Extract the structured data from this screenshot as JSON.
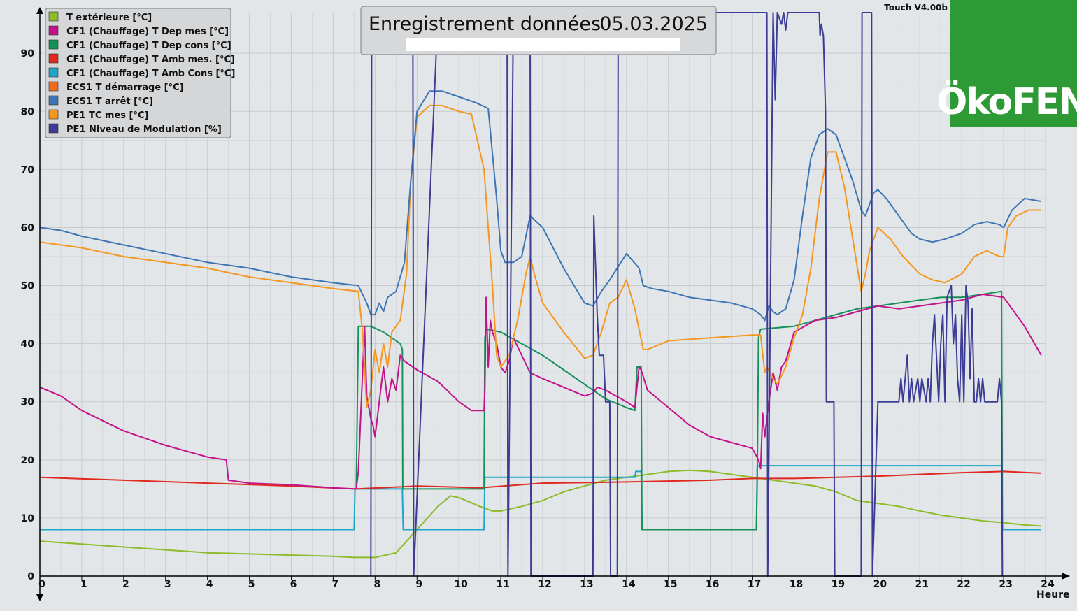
{
  "window": {
    "title_left": "Enregistrement données",
    "title_date": "05.03.2025",
    "version": "Touch V4.00b",
    "logo_text": "ÖkoFEN",
    "logo_bg": "#2e9a36"
  },
  "chart_data": {
    "type": "line",
    "title": "Enregistrement données 05.03.2025",
    "xlabel": "Heure",
    "ylabel": "",
    "xlim": [
      0,
      24
    ],
    "ylim": [
      0,
      97
    ],
    "xticks": [
      0,
      1,
      2,
      3,
      4,
      5,
      6,
      7,
      8,
      9,
      10,
      11,
      12,
      13,
      14,
      15,
      16,
      17,
      18,
      19,
      20,
      21,
      22,
      23,
      24
    ],
    "yticks": [
      0,
      10,
      20,
      30,
      40,
      50,
      60,
      70,
      80,
      90
    ],
    "grid": true,
    "legend_position": "top-left",
    "series": [
      {
        "name": "T extérieure [°C]",
        "color": "#8dbb2a",
        "x": [
          0,
          1,
          2,
          3,
          4,
          5,
          6,
          7,
          7.5,
          8,
          8.5,
          9,
          9.5,
          9.8,
          10,
          10.5,
          10.8,
          11,
          11.5,
          12,
          12.5,
          13,
          13.5,
          14,
          14.5,
          15,
          15.5,
          16,
          16.5,
          17,
          17.5,
          18,
          18.5,
          19,
          19.5,
          20,
          20.5,
          21,
          21.5,
          22,
          22.5,
          23,
          23.5,
          23.9
        ],
        "y": [
          6,
          5.5,
          5,
          4.5,
          4,
          3.8,
          3.6,
          3.4,
          3.2,
          3.2,
          4,
          8,
          12,
          13.8,
          13.5,
          12,
          11.2,
          11.2,
          12,
          13,
          14.5,
          15.5,
          16.5,
          17,
          17.5,
          18,
          18.2,
          18,
          17.5,
          17,
          16.5,
          16,
          15.5,
          14.5,
          13,
          12.5,
          12,
          11.2,
          10.5,
          10,
          9.5,
          9.2,
          8.8,
          8.6
        ]
      },
      {
        "name": "CF1 (Chauffage) T Dep mes [°C]",
        "color": "#c3138a",
        "x": [
          0,
          0.5,
          1,
          2,
          3,
          4,
          4.45,
          4.5,
          5,
          6,
          7,
          7.55,
          7.6,
          7.7,
          7.75,
          7.8,
          7.9,
          7.95,
          8,
          8.1,
          8.2,
          8.3,
          8.4,
          8.5,
          8.6,
          8.7,
          9,
          9.5,
          10,
          10.3,
          10.6,
          10.62,
          10.65,
          10.7,
          10.75,
          10.8,
          10.9,
          11,
          11.1,
          11.2,
          11.3,
          11.5,
          11.7,
          12,
          12.5,
          13,
          13.2,
          13.3,
          13.5,
          14,
          14.2,
          14.3,
          14.35,
          14.5,
          15,
          15.5,
          16,
          16.5,
          17,
          17.15,
          17.2,
          17.25,
          17.3,
          17.4,
          17.5,
          17.6,
          17.7,
          17.8,
          18,
          18.5,
          19,
          19.5,
          20,
          20.5,
          21,
          21.5,
          22,
          22.5,
          23,
          23.5,
          23.9
        ],
        "y": [
          32.5,
          31,
          28.5,
          25,
          22.5,
          20.5,
          20,
          16.5,
          16,
          15.7,
          15.2,
          15,
          18,
          35,
          43,
          31,
          27,
          26,
          24,
          30,
          36,
          30,
          34,
          32,
          38,
          37,
          35.5,
          33.5,
          30,
          28.5,
          28.5,
          32,
          48,
          36,
          44,
          42,
          40,
          36,
          35,
          37,
          41,
          38,
          35,
          34,
          32.5,
          31,
          31.5,
          32.5,
          32,
          30,
          29,
          36,
          35.5,
          32,
          29,
          26,
          24,
          23,
          22,
          20,
          18.5,
          28,
          24,
          30,
          35,
          32,
          36,
          37,
          42,
          44,
          44.5,
          45.5,
          46.5,
          46,
          46.5,
          47,
          47.5,
          48.5,
          48,
          43,
          38
        ]
      },
      {
        "name": "CF1 (Chauffage) T Dep cons [°C]",
        "color": "#14925a",
        "x": [
          7.55,
          7.6,
          7.9,
          8.2,
          8.4,
          8.6,
          8.65,
          8.66,
          10.58,
          10.6,
          10.62,
          10.65,
          11,
          11.5,
          12,
          12.5,
          13,
          13.5,
          14,
          14.2,
          14.25,
          14.35,
          14.37,
          17.1,
          17.12,
          17.15,
          17.2,
          18,
          18.5,
          19,
          19.5,
          20,
          20.5,
          21,
          21.5,
          22,
          22.5,
          22.95,
          22.97
        ],
        "y": [
          15,
          43,
          43,
          42,
          41,
          40,
          39,
          15,
          15,
          15,
          41,
          42.5,
          42,
          40,
          38,
          35.5,
          33,
          30.5,
          29,
          28.5,
          36,
          36,
          8,
          8,
          17,
          41,
          42.5,
          43,
          44,
          45,
          46,
          46.5,
          47,
          47.5,
          48,
          48,
          48.5,
          49,
          8
        ]
      },
      {
        "name": "CF1 (Chauffage) T Amb mes. [°C]",
        "color": "#e0281e",
        "x": [
          0,
          2,
          4,
          6,
          7.5,
          9,
          10.5,
          12,
          14,
          16,
          17,
          18,
          20,
          22,
          23,
          23.9
        ],
        "y": [
          17,
          16.5,
          16,
          15.5,
          15,
          15.5,
          15.2,
          16,
          16.2,
          16.5,
          16.8,
          16.8,
          17.2,
          17.8,
          18,
          17.7
        ]
      },
      {
        "name": "CF1 (Chauffage) T Amb Cons [°C]",
        "color": "#1ea5c8",
        "x": [
          0,
          7.5,
          7.52,
          8.65,
          8.67,
          10.6,
          10.62,
          14.2,
          14.22,
          14.35,
          14.37,
          17.1,
          17.12,
          22.95,
          22.97,
          23.9
        ],
        "y": [
          8,
          8,
          15,
          15,
          8,
          8,
          17,
          17,
          18,
          18,
          8,
          8,
          19,
          19,
          8,
          8
        ]
      },
      {
        "name": "ECS1 T démarrage [°C]",
        "color": "#ec6d22",
        "x": [],
        "y": []
      },
      {
        "name": "ECS1 T arrêt [°C]",
        "color": "#3e76b4",
        "x": [
          0,
          0.5,
          1,
          2,
          3,
          4,
          5,
          6,
          7,
          7.6,
          7.8,
          7.9,
          8,
          8.05,
          8.1,
          8.2,
          8.3,
          8.5,
          8.7,
          8.85,
          9,
          9.3,
          9.6,
          10,
          10.4,
          10.7,
          10.9,
          11,
          11.1,
          11.3,
          11.5,
          11.7,
          12,
          12.5,
          13,
          13.2,
          13.4,
          13.6,
          14,
          14.3,
          14.4,
          14.6,
          15,
          15.5,
          16,
          16.5,
          17,
          17.2,
          17.3,
          17.4,
          17.5,
          17.6,
          17.8,
          18,
          18.2,
          18.4,
          18.6,
          18.8,
          19,
          19.2,
          19.4,
          19.6,
          19.7,
          19.8,
          19.9,
          20,
          20.2,
          20.5,
          20.8,
          21,
          21.3,
          21.6,
          22,
          22.3,
          22.6,
          22.9,
          23,
          23.2,
          23.5,
          23.9
        ],
        "y": [
          60,
          59.5,
          58.5,
          57,
          55.5,
          54,
          53,
          51.5,
          50.5,
          50,
          47,
          45,
          45,
          46,
          47,
          45.5,
          48,
          49,
          54,
          68,
          80,
          83.5,
          83.5,
          82.5,
          81.5,
          80.5,
          65,
          56,
          54,
          54,
          55,
          62,
          60,
          53,
          47,
          46.5,
          49,
          51,
          55.5,
          53,
          50,
          49.5,
          49,
          48,
          47.5,
          47,
          46,
          45,
          44,
          46.5,
          45.5,
          45,
          46,
          51,
          62,
          72,
          76,
          77,
          76,
          72,
          68,
          63,
          62,
          64,
          66,
          66.5,
          65,
          62,
          59,
          58,
          57.5,
          58,
          59,
          60.5,
          61,
          60.5,
          60,
          63,
          65,
          64.5
        ]
      },
      {
        "name": "PE1 TC mes [°C]",
        "color": "#f5961e",
        "x": [
          0,
          0.5,
          1,
          2,
          3,
          4,
          5,
          6,
          7,
          7.6,
          7.7,
          7.8,
          7.9,
          8,
          8.1,
          8.2,
          8.3,
          8.4,
          8.6,
          8.75,
          8.85,
          9,
          9.3,
          9.6,
          10,
          10.3,
          10.6,
          10.8,
          10.9,
          11,
          11.2,
          11.4,
          11.6,
          11.7,
          11.8,
          12,
          12.5,
          13,
          13.2,
          13.4,
          13.6,
          13.8,
          14,
          14.2,
          14.4,
          14.5,
          15,
          16,
          17,
          17.2,
          17.3,
          17.35,
          17.5,
          17.6,
          17.8,
          18,
          18.2,
          18.4,
          18.6,
          18.8,
          19,
          19.2,
          19.4,
          19.6,
          19.7,
          19.8,
          20,
          20.3,
          20.6,
          21,
          21.3,
          21.6,
          22,
          22.3,
          22.6,
          22.9,
          23,
          23.1,
          23.3,
          23.6,
          23.9
        ],
        "y": [
          57.5,
          57,
          56.5,
          55,
          54,
          53,
          51.5,
          50.5,
          49.5,
          49,
          42,
          29,
          32,
          39,
          35,
          40,
          36,
          42,
          44,
          52,
          68,
          79,
          81,
          81,
          80,
          79.5,
          70,
          50,
          38,
          36,
          38,
          44,
          52,
          55,
          52,
          47,
          42,
          37.5,
          38,
          42,
          47,
          48,
          51,
          46,
          39,
          39,
          40.5,
          41,
          41.5,
          41.5,
          35,
          36,
          34,
          33,
          36,
          41,
          45,
          53,
          65,
          73,
          73,
          67,
          58,
          49,
          52,
          56,
          60,
          58,
          55,
          52,
          51,
          50.5,
          52,
          55,
          56,
          55,
          55,
          60,
          62,
          63,
          63
        ]
      },
      {
        "name": "PE1 Niveau de Modulation [%]",
        "color": "#3c3c96",
        "x": [
          7.9,
          7.92,
          8.9,
          8.92,
          9.5,
          11.15,
          11.17,
          11.3,
          11.7,
          11.72,
          13.2,
          13.22,
          13.3,
          13.35,
          13.45,
          13.5,
          13.6,
          13.62,
          13.78,
          13.8,
          17.35,
          17.37,
          17.5,
          17.55,
          17.6,
          17.7,
          17.75,
          17.8,
          17.85,
          18.5,
          18.6,
          18.62,
          18.65,
          18.7,
          18.75,
          18.77,
          18.95,
          18.97,
          19.6,
          19.62,
          19.85,
          19.87,
          20,
          20.5,
          20.55,
          20.6,
          20.7,
          20.75,
          20.8,
          20.85,
          20.95,
          21,
          21.05,
          21.15,
          21.2,
          21.25,
          21.3,
          21.35,
          21.45,
          21.5,
          21.55,
          21.6,
          21.65,
          21.75,
          21.8,
          21.85,
          21.9,
          21.95,
          22,
          22.05,
          22.1,
          22.15,
          22.2,
          22.25,
          22.3,
          22.35,
          22.4,
          22.45,
          22.5,
          22.55,
          22.6,
          22.65,
          22.7,
          22.75,
          22.8,
          22.85,
          22.9,
          22.95,
          22.97
        ],
        "y": [
          0,
          97,
          97,
          0,
          97,
          97,
          0,
          97,
          97,
          0,
          0,
          62,
          45,
          38,
          38,
          30,
          30,
          0,
          0,
          97,
          97,
          0,
          97,
          82,
          97,
          95,
          97,
          94,
          97,
          97,
          97,
          93,
          95,
          93,
          80,
          30,
          30,
          0,
          0,
          97,
          97,
          0,
          30,
          30,
          34,
          30,
          38,
          30,
          34,
          30,
          34,
          30,
          34,
          30,
          34,
          30,
          40,
          45,
          30,
          40,
          45,
          30,
          48,
          50,
          40,
          45,
          34,
          30,
          45,
          30,
          50,
          47,
          34,
          46,
          30,
          30,
          34,
          30,
          34,
          30,
          30,
          30,
          30,
          30,
          30,
          30,
          34,
          30,
          0
        ]
      }
    ]
  }
}
